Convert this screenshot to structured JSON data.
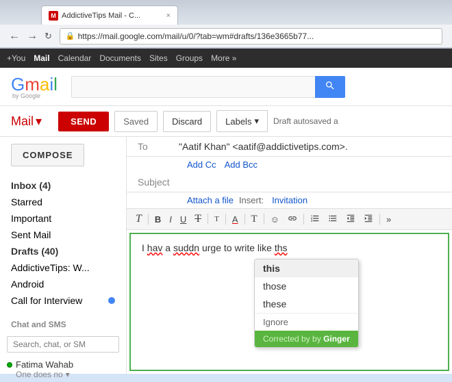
{
  "browser": {
    "tab": {
      "favicon": "M",
      "title": "AddictiveTips Mail - C...",
      "close": "×"
    },
    "nav": {
      "back": "←",
      "forward": "→",
      "refresh": "↻",
      "url": "https://mail.google.com/mail/u/0/?tab=wm#drafts/136e3665b77..."
    }
  },
  "google_bar": {
    "links": [
      "+You",
      "Mail",
      "Calendar",
      "Documents",
      "Sites",
      "Groups"
    ],
    "more": "More »"
  },
  "gmail_header": {
    "logo": "Gmail",
    "search_placeholder": "",
    "search_btn_label": "Search"
  },
  "mail_subheader": {
    "mail_label": "Mail",
    "mail_arrow": "▾",
    "send_btn": "SEND",
    "saved_btn": "Saved",
    "discard_btn": "Discard",
    "labels_btn": "Labels",
    "labels_arrow": "▾",
    "draft_status": "Draft autosaved a"
  },
  "sidebar": {
    "compose_btn": "COMPOSE",
    "nav_items": [
      {
        "label": "Inbox",
        "count": "(4)",
        "bold": true
      },
      {
        "label": "Starred",
        "count": "",
        "bold": false
      },
      {
        "label": "Important",
        "count": "",
        "bold": false
      },
      {
        "label": "Sent Mail",
        "count": "",
        "bold": false
      },
      {
        "label": "Drafts",
        "count": "(40)",
        "bold": true
      }
    ],
    "more_items": [
      {
        "label": "AddictiveTips: W...",
        "count": "",
        "bold": false
      },
      {
        "label": "Android",
        "count": "",
        "bold": false
      },
      {
        "label": "Call for Interview",
        "dot": "blue",
        "bold": false
      }
    ],
    "chat_section": "Chat and SMS",
    "chat_search_placeholder": "Search, chat, or SM",
    "online_user": {
      "name": "Fatima Wahab",
      "status": "One does no",
      "status_arrow": "▾"
    }
  },
  "compose": {
    "to_label": "To",
    "to_value": "\"Aatif Khan\" <aatif@addictivetips.com>.",
    "add_cc": "Add Cc",
    "add_bcc": "Add Bcc",
    "subject_label": "Subject",
    "attach_label": "Attach a file",
    "insert_label": "Insert:",
    "invitation_label": "Invitation",
    "body_text": "I hav a suddn urge to write like ths",
    "underlined_words": [
      "hav",
      "suddn",
      "ths"
    ],
    "formatting": {
      "font_size": "T",
      "bold": "B",
      "italic": "I",
      "underline": "U",
      "strikethrough": "T",
      "text_size": "T",
      "font_color": "A",
      "text_color": "T",
      "emoji": "☺",
      "link": "🔗",
      "ol": "≡",
      "ul": "≡",
      "indent_less": "≡",
      "indent_more": "≡",
      "more": "»"
    }
  },
  "autocorrect": {
    "suggestions": [
      "this",
      "those",
      "these"
    ],
    "ignore": "Ignore",
    "corrected_by": "Corrected by",
    "brand": "Ginger"
  }
}
